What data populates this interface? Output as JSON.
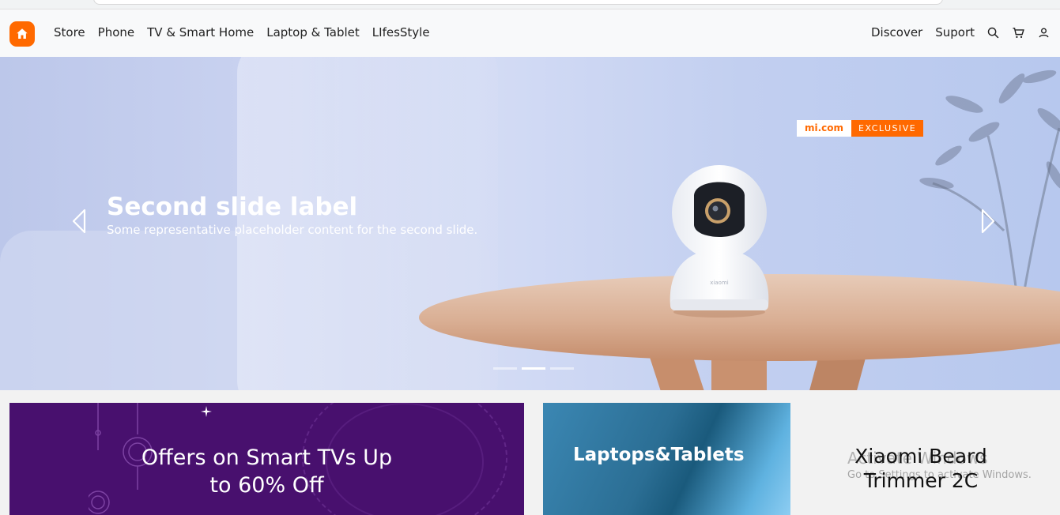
{
  "nav": {
    "left_links": [
      "Store",
      "Phone",
      "TV & Smart Home",
      "Laptop & Tablet",
      "LIfesStyle"
    ],
    "right_links": [
      "Discover",
      "Suport"
    ],
    "icons": [
      "home-icon",
      "search-icon",
      "cart-icon",
      "user-icon"
    ],
    "brand_color": "#ff6900"
  },
  "hero": {
    "badge_site": "mi.com",
    "badge_tag": "EXCLUSIVE",
    "caption_title": "Second slide label",
    "caption_text": "Some representative placeholder content for the second slide.",
    "product_text": "xiaomi",
    "slides_count": 3,
    "active_slide": 2
  },
  "cards": {
    "tv_title_line1": "Offers on Smart TVs Up",
    "tv_title_line2": "to 60% Off",
    "laptop_title": "Laptops&Tablets",
    "beard_title_line1": "Xiaomi Beard",
    "beard_title_line2": "Trimmer 2C"
  },
  "watermark": {
    "line1": "Activate Windows",
    "line2": "Go to Settings to activate Windows."
  }
}
